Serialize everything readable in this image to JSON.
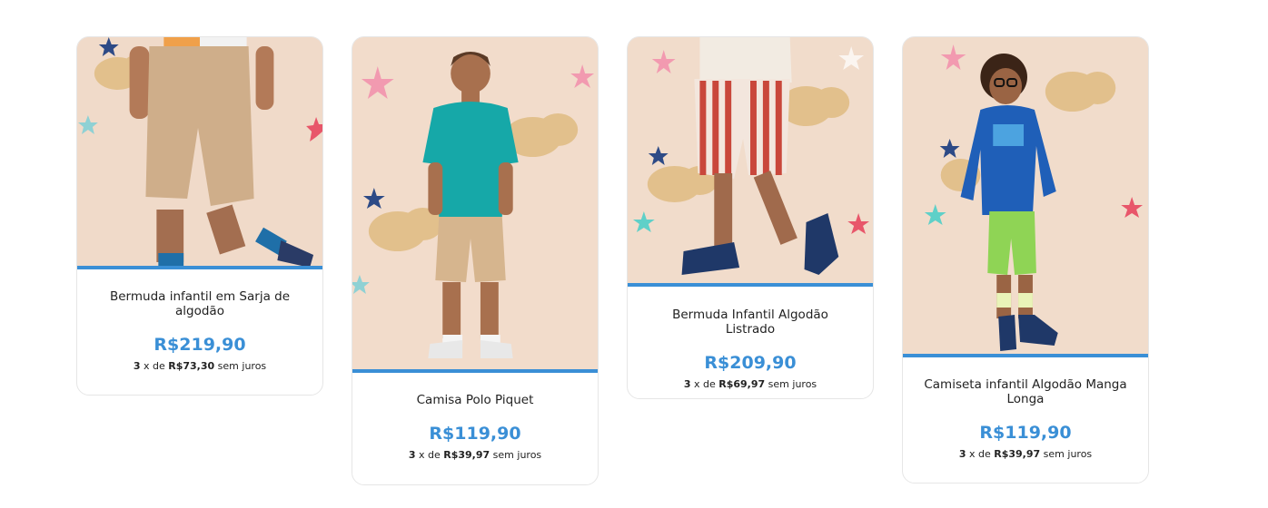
{
  "colors": {
    "accent": "#3a8fd6",
    "price": "#3a8fd6",
    "photo_background": "#f1d9c8"
  },
  "products": [
    {
      "name": "Bermuda infantil em Sarja de algodão",
      "price": "R$219,90",
      "installments": {
        "count": "3",
        "x_de": "x de",
        "amount": "R$73,30",
        "suffix": "sem juros"
      },
      "image_icon": "boy-beige-shorts-photo"
    },
    {
      "name": "Camisa Polo Piquet",
      "price": "R$119,90",
      "installments": {
        "count": "3",
        "x_de": "x de",
        "amount": "R$39,97",
        "suffix": "sem juros"
      },
      "image_icon": "boy-teal-polo-photo"
    },
    {
      "name": "Bermuda Infantil Algodão Listrado",
      "price": "R$209,90",
      "installments": {
        "count": "3",
        "x_de": "x de",
        "amount": "R$69,97",
        "suffix": "sem juros"
      },
      "image_icon": "boy-striped-shorts-photo"
    },
    {
      "name": "Camiseta infantil Algodão Manga Longa",
      "price": "R$119,90",
      "installments": {
        "count": "3",
        "x_de": "x de",
        "amount": "R$39,97",
        "suffix": "sem juros"
      },
      "image_icon": "boy-blue-longsleeve-photo"
    }
  ]
}
